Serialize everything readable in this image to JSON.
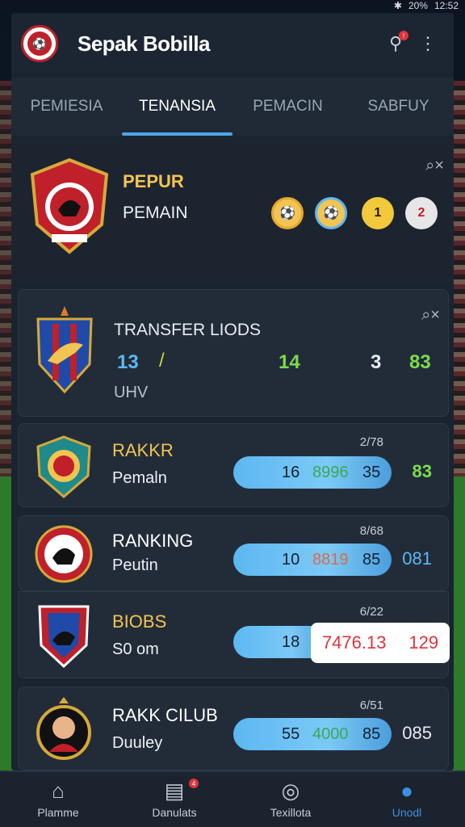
{
  "status": {
    "bluetooth": "✱",
    "battery": "20%",
    "time": "12:52"
  },
  "header": {
    "title": "Sepak Bobilla"
  },
  "tabs": [
    {
      "label": "PEMIESIA"
    },
    {
      "label": "TENANSIA"
    },
    {
      "label": "PEMACIN"
    },
    {
      "label": "SABFUY"
    }
  ],
  "top_card": {
    "title": "PEPUR",
    "subtitle": "PEMAIN",
    "close": "⌕×",
    "badges": [
      "⚽",
      "⚽",
      "1",
      "2"
    ]
  },
  "transfer_card": {
    "title": "TRANSFER LIODS",
    "close": "⌕×",
    "val1": "13",
    "val2": "14",
    "val3": "3",
    "val4": "83",
    "sub": "UHV"
  },
  "rows": [
    {
      "title": "RAKKR",
      "subtitle": "Pemaln",
      "date": "2/78",
      "pill_a": "16",
      "pill_mid": "8996",
      "pill_b": "35",
      "right": "83"
    },
    {
      "title": "RANKING",
      "subtitle": "Peutin",
      "date": "8/68",
      "pill_a": "10",
      "pill_mid": "8819",
      "pill_b": "85",
      "right": "081"
    },
    {
      "title": "BIOBS",
      "subtitle": "S0 om",
      "date": "6/22",
      "pill_a": "18",
      "pill_mid": "",
      "pill_b": "",
      "highlight_a": "7476.13",
      "highlight_b": "129"
    },
    {
      "title": "RAKK CILUB",
      "subtitle": "Duuley",
      "date": "6/51",
      "pill_a": "55",
      "pill_mid": "4000",
      "pill_b": "85",
      "right": "085"
    }
  ],
  "nav": [
    {
      "label": "Plamme",
      "icon": "home-icon"
    },
    {
      "label": "Danulats",
      "icon": "document-icon",
      "badge": "4"
    },
    {
      "label": "Texillota",
      "icon": "whistle-icon"
    },
    {
      "label": "Unodl",
      "icon": "user-icon"
    }
  ],
  "colors": {
    "accent": "#4aa8e8",
    "gold": "#f2c451",
    "green": "#7bdc4a",
    "red": "#e0333c"
  }
}
